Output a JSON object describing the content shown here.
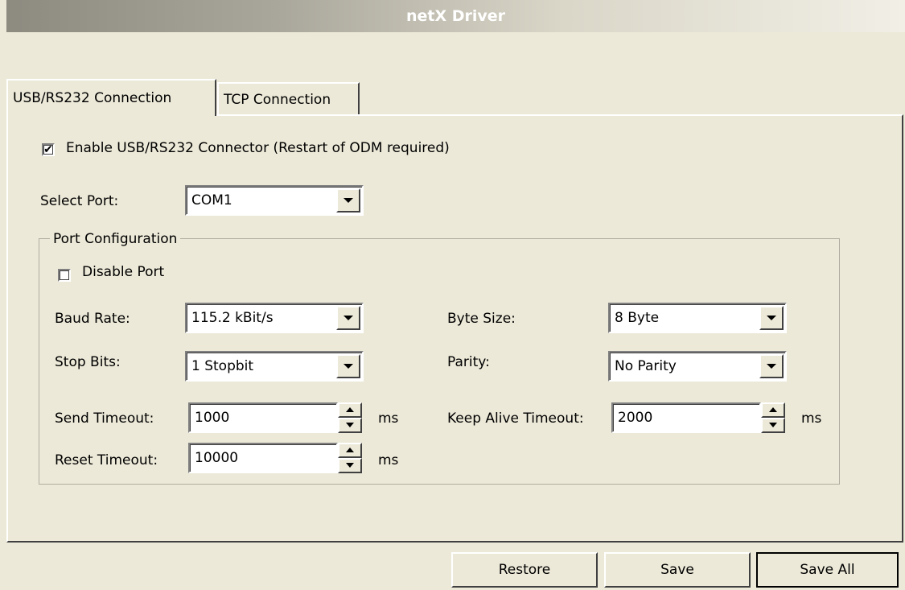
{
  "window": {
    "title": "netX Driver"
  },
  "tabs": [
    {
      "label": "USB/RS232 Connection",
      "active": true
    },
    {
      "label": "TCP Connection",
      "active": false
    }
  ],
  "enable_connector": {
    "label": "Enable USB/RS232 Connector (Restart of ODM required)",
    "checked": true,
    "check_glyph": "✔"
  },
  "select_port": {
    "label": "Select Port:",
    "value": "COM1"
  },
  "port_config": {
    "title": "Port Configuration",
    "disable_port": {
      "label": "Disable Port",
      "checked": false
    },
    "baud_rate": {
      "label": "Baud Rate:",
      "value": "115.2  kBit/s"
    },
    "byte_size": {
      "label": "Byte Size:",
      "value": "8 Byte"
    },
    "stop_bits": {
      "label": "Stop Bits:",
      "value": "1 Stopbit"
    },
    "parity": {
      "label": "Parity:",
      "value": "No Parity"
    },
    "send_timeout": {
      "label": "Send Timeout:",
      "value": "1000",
      "unit": "ms"
    },
    "keep_alive_timeout": {
      "label": "Keep Alive Timeout:",
      "value": "2000",
      "unit": "ms"
    },
    "reset_timeout": {
      "label": "Reset Timeout:",
      "value": "10000",
      "unit": "ms"
    }
  },
  "buttons": {
    "restore": "Restore",
    "save": "Save",
    "save_all": "Save All"
  },
  "colors": {
    "face": "#ece9d8",
    "field": "#ffffff",
    "shadow": "#404040"
  }
}
